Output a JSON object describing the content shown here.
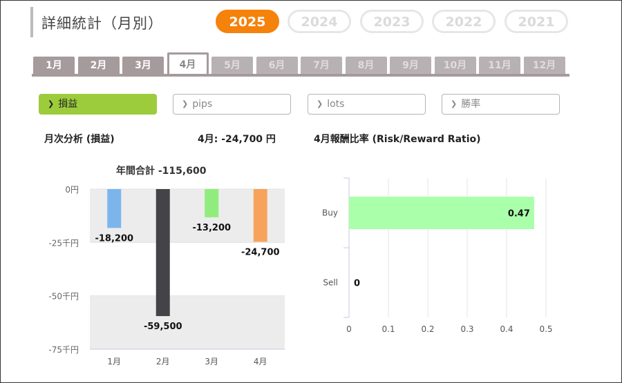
{
  "header": {
    "title": "詳細統計（月別）"
  },
  "years": [
    {
      "label": "2025",
      "active": true
    },
    {
      "label": "2024",
      "active": false
    },
    {
      "label": "2023",
      "active": false
    },
    {
      "label": "2022",
      "active": false
    },
    {
      "label": "2021",
      "active": false
    }
  ],
  "months": [
    {
      "label": "1月",
      "state": "past"
    },
    {
      "label": "2月",
      "state": "past"
    },
    {
      "label": "3月",
      "state": "past"
    },
    {
      "label": "4月",
      "state": "active"
    },
    {
      "label": "5月",
      "state": "future"
    },
    {
      "label": "6月",
      "state": "future"
    },
    {
      "label": "7月",
      "state": "future"
    },
    {
      "label": "8月",
      "state": "future"
    },
    {
      "label": "9月",
      "state": "future"
    },
    {
      "label": "10月",
      "state": "future"
    },
    {
      "label": "11月",
      "state": "future"
    },
    {
      "label": "12月",
      "state": "future"
    }
  ],
  "metrics": [
    {
      "label": "損益",
      "active": true
    },
    {
      "label": "pips",
      "active": false
    },
    {
      "label": "lots",
      "active": false
    },
    {
      "label": "勝率",
      "active": false
    }
  ],
  "monthly": {
    "heading": "月次分析 (損益)",
    "current": "4月:  -24,700 円",
    "total": "年間合計 -115,600"
  },
  "rr": {
    "heading": "4月報酬比率 (Risk/Reward Ratio)"
  },
  "chart_data": [
    {
      "type": "bar",
      "categories": [
        "1月",
        "2月",
        "3月",
        "4月"
      ],
      "values": [
        -18200,
        -59500,
        -13200,
        -24700
      ],
      "value_labels": [
        "-18,200",
        "-59,500",
        "-13,200",
        "-24,700"
      ],
      "colors": [
        "#7cb5ec",
        "#434348",
        "#90ed7d",
        "#f7a35c"
      ],
      "ylim": [
        -75000,
        0
      ],
      "yticks": [
        0,
        -25000,
        -50000,
        -75000
      ],
      "ytick_labels": [
        "0円",
        "-25千円",
        "-50千円",
        "-75千円"
      ],
      "title": "年間合計 -115,600",
      "xlabel": "",
      "ylabel": ""
    },
    {
      "type": "bar",
      "orientation": "horizontal",
      "categories": [
        "Buy",
        "Sell"
      ],
      "values": [
        0.47,
        0
      ],
      "value_labels": [
        "0.47",
        "0"
      ],
      "colors": [
        "#aaffaa",
        "#aaffaa"
      ],
      "xlim": [
        0,
        0.5
      ],
      "xticks": [
        0,
        0.1,
        0.2,
        0.3,
        0.4,
        0.5
      ],
      "xtick_labels": [
        "0",
        "0.1",
        "0.2",
        "0.3",
        "0.4",
        "0.5"
      ],
      "title": "4月報酬比率 (Risk/Reward Ratio)",
      "grid": true
    }
  ]
}
